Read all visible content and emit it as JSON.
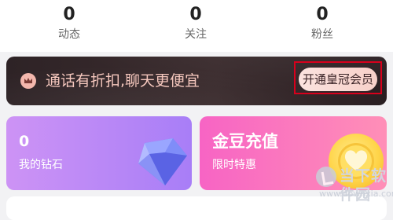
{
  "stats": [
    {
      "value": "0",
      "label": "动态"
    },
    {
      "value": "0",
      "label": "关注"
    },
    {
      "value": "0",
      "label": "粉丝"
    }
  ],
  "banner": {
    "text": "通话有折扣,聊天更便宜",
    "button_label": "开通皇冠会员",
    "icon": "crown-icon"
  },
  "cards": {
    "diamonds": {
      "value": "0",
      "label": "我的钻石",
      "icon": "diamond-icon"
    },
    "recharge": {
      "title": "金豆充值",
      "subtitle": "限时特惠",
      "icon": "gold-coin-icon"
    }
  },
  "watermark": {
    "name": "当下软件园",
    "url": "www.downxia.com"
  },
  "colors": {
    "banner_text": "#f6c8be",
    "highlight_frame": "#d8001c",
    "diamond_card": "#b486f6",
    "recharge_card": "#f96cc0"
  }
}
